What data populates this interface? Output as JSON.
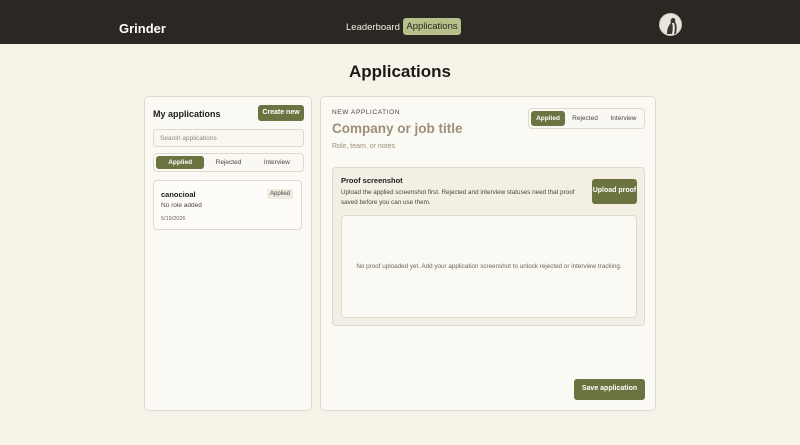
{
  "header": {
    "brand": "Grinder",
    "nav": [
      {
        "label": "Leaderboard"
      },
      {
        "label": "Applications",
        "active": true
      }
    ],
    "avatar_icon": "user-avatar-icon"
  },
  "page": {
    "title": "Applications"
  },
  "sidebar": {
    "title": "My applications",
    "create_label": "Create new",
    "search": {
      "placeholder": "Search applications",
      "value": ""
    },
    "filters": [
      {
        "label": "Applied",
        "active": true
      },
      {
        "label": "Rejected",
        "active": false
      },
      {
        "label": "Interview",
        "active": false
      }
    ],
    "applications": [
      {
        "company": "canocioal",
        "status": "Applied",
        "role": "No role added",
        "date": "5/19/2026"
      }
    ]
  },
  "form": {
    "section_label": "NEW APPLICATION",
    "company_placeholder": "Company or job title",
    "role_placeholder": "Role, team, or notes",
    "status_options": [
      {
        "label": "Applied",
        "active": true
      },
      {
        "label": "Rejected",
        "active": false
      },
      {
        "label": "Interview",
        "active": false
      }
    ],
    "proof": {
      "title": "Proof screenshot",
      "description": "Upload the applied screenshot first. Rejected and interview statuses need that proof saved before you can use them.",
      "upload_label": "Upload proof",
      "empty_text": "No proof uploaded yet. Add your application screenshot to unlock rejected or interview tracking."
    },
    "save_label": "Save application"
  },
  "colors": {
    "topbar": "#2b2722",
    "accent": "#6b7440",
    "nav_active": "#b7c08a",
    "background": "#f7f3e9"
  }
}
